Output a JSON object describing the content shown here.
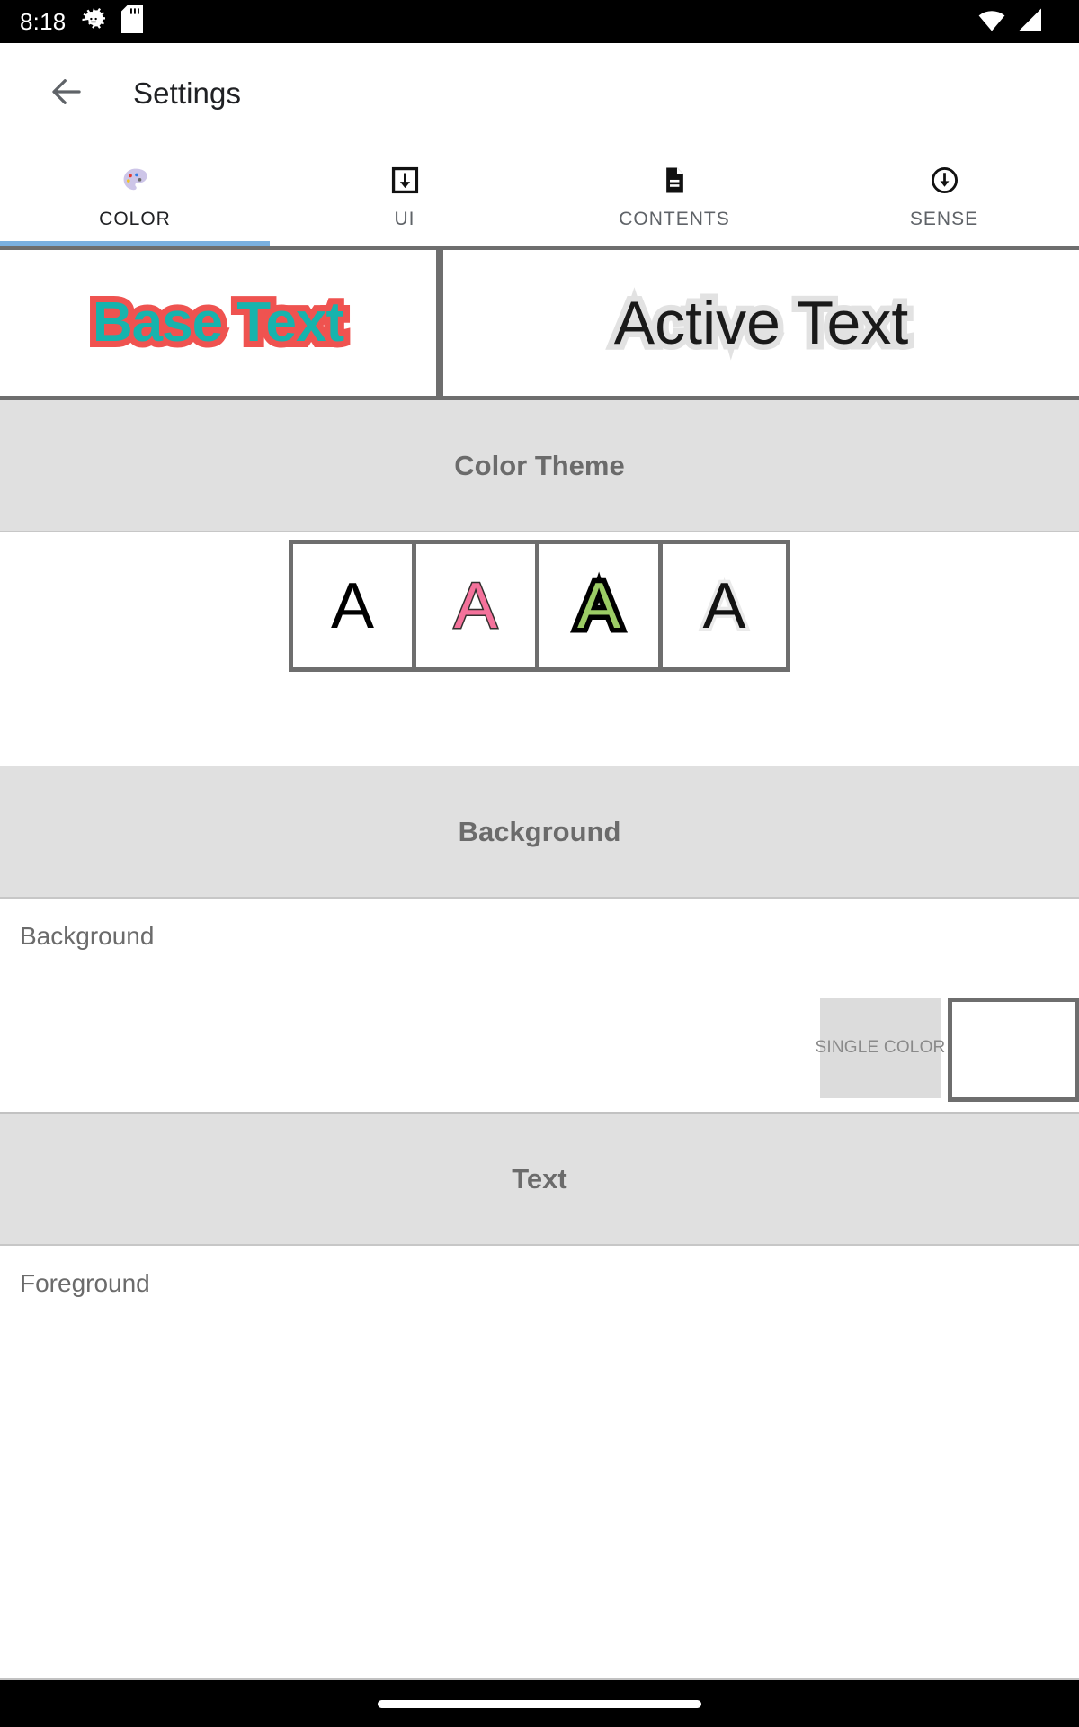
{
  "status_bar": {
    "clock": "8:18",
    "left_icons": [
      "android-gear-icon",
      "sd-card-icon"
    ],
    "right_icons": [
      "wifi-icon",
      "signal-icon"
    ],
    "background": "#000000",
    "foreground": "#ffffff"
  },
  "app_bar": {
    "back_icon": "back-arrow-icon",
    "title": "Settings"
  },
  "tabs": {
    "indicator_color": "#7ab0e0",
    "active_index": 0,
    "items": [
      {
        "label": "COLOR",
        "icon": "palette-icon",
        "active": true
      },
      {
        "label": "UI",
        "icon": "download-box-icon",
        "active": false
      },
      {
        "label": "CONTENTS",
        "icon": "document-icon",
        "active": false
      },
      {
        "label": "SENSE",
        "icon": "circle-down-arrow-icon",
        "active": false
      }
    ]
  },
  "preview": {
    "base": {
      "text": "Base Text",
      "fill_color": "#17b3ad",
      "stroke_color": "#ef5350"
    },
    "active": {
      "text": "Active Text",
      "fill_color": "#1a1a1a",
      "stroke_color": "#e2e2e2"
    }
  },
  "sections": [
    {
      "title": "Color Theme"
    },
    {
      "title": "Background"
    },
    {
      "title": "Text"
    }
  ],
  "color_theme": {
    "title": "Color Theme",
    "swatches": [
      {
        "letter": "A",
        "fill": "#000000",
        "stroke": "none",
        "selected": false
      },
      {
        "letter": "A",
        "fill": "#f4729b",
        "stroke": "#33302f",
        "selected": false
      },
      {
        "letter": "A",
        "fill": "#9ccc65",
        "stroke": "#000000",
        "selected": false
      },
      {
        "letter": "A",
        "fill": "#121212",
        "stroke": "#eaeaea",
        "selected": false
      }
    ]
  },
  "background_section": {
    "title": "Background",
    "row_label": "Background",
    "mode_button": "SINGLE COLOR",
    "color_value": "#ffffff"
  },
  "text_section": {
    "title": "Text",
    "row_label": "Foreground"
  },
  "nav_bar": {
    "handle": "home-gesture-pill"
  }
}
